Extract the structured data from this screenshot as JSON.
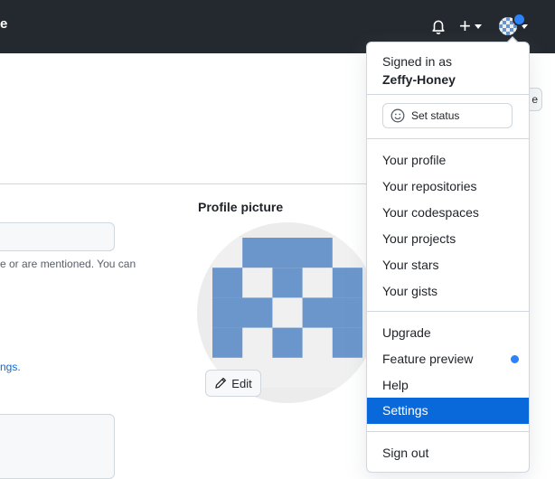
{
  "header": {
    "brand_fragment": "e",
    "icons": [
      "bell-icon",
      "plus-icon",
      "avatar"
    ]
  },
  "background": {
    "help_fragment": "e or are mentioned. You can",
    "link_fragment": "ngs.",
    "profile_picture_title": "Profile picture",
    "edit_label": "Edit",
    "peek_button_fragment": "e"
  },
  "menu": {
    "signed_in_as": "Signed in as",
    "username": "Zeffy-Honey",
    "set_status": "Set status",
    "group1": [
      "Your profile",
      "Your repositories",
      "Your codespaces",
      "Your projects",
      "Your stars",
      "Your gists"
    ],
    "group2": [
      "Upgrade",
      "Feature preview",
      "Help",
      "Settings"
    ],
    "sign_out": "Sign out",
    "active_item": "Settings"
  },
  "colors": {
    "header_bg": "#24292f",
    "accent": "#0969da",
    "avatar_blue": "#6a96cc",
    "notification_dot": "#2f81f7"
  }
}
